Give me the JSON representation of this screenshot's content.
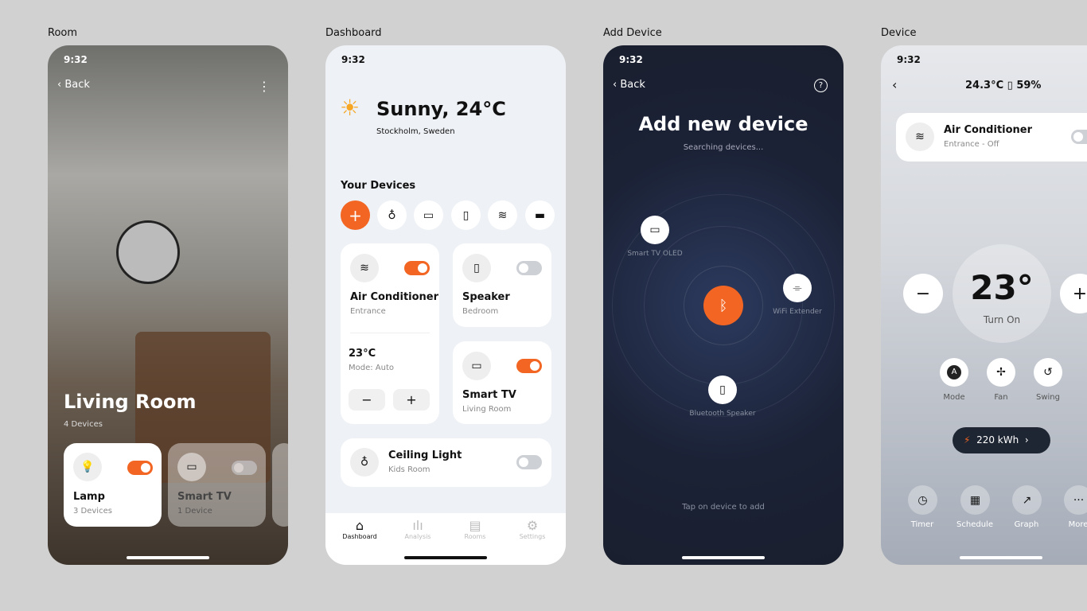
{
  "screens": {
    "room": "Room",
    "dashboard": "Dashboard",
    "add": "Add Device",
    "device": "Device"
  },
  "status": {
    "time": "9:32",
    "signal": "▮▮▮ ◠ ▬"
  },
  "room": {
    "back": "Back",
    "menu": "⋮",
    "title": "Living Room",
    "subtitle": "4 Devices",
    "cards": [
      {
        "name": "Lamp",
        "sub": "3 Devices",
        "on": true,
        "icon": "bulb-icon"
      },
      {
        "name": "Smart TV",
        "sub": "1 Device",
        "on": false,
        "icon": "tv-icon"
      }
    ]
  },
  "dashboard": {
    "weather": "Sunny, 24°C",
    "location": "Stockholm, Sweden",
    "section": "Your Devices",
    "ac": {
      "name": "Air Conditioner",
      "room": "Entrance",
      "on": true,
      "temp": "23°C",
      "mode": "Mode: Auto",
      "minus": "−",
      "plus": "+"
    },
    "speaker": {
      "name": "Speaker",
      "room": "Bedroom",
      "on": false
    },
    "tv": {
      "name": "Smart TV",
      "room": "Living Room",
      "on": true
    },
    "light": {
      "name": "Ceiling Light",
      "room": "Kids Room",
      "on": false
    },
    "nav": [
      "Dashboard",
      "Analysis",
      "Rooms",
      "Settings"
    ]
  },
  "add": {
    "back": "Back",
    "title": "Add new device",
    "sub": "Searching devices...",
    "devices": [
      "Smart TV OLED",
      "WiFi Extender",
      "Bluetooth Speaker"
    ],
    "hint": "Tap on device to add"
  },
  "device": {
    "temp": "24.3°C",
    "humidity": "59%",
    "name": "Air Conditioner",
    "meta": "Entrance  -  Off",
    "setpoint": "23°",
    "state": "Turn On",
    "modes": [
      "Mode",
      "Fan",
      "Swing"
    ],
    "energy": "220 kWh",
    "actions": [
      "Timer",
      "Schedule",
      "Graph",
      "More"
    ]
  },
  "colors": {
    "accent": "#f26522",
    "dark": "#1c2333"
  }
}
